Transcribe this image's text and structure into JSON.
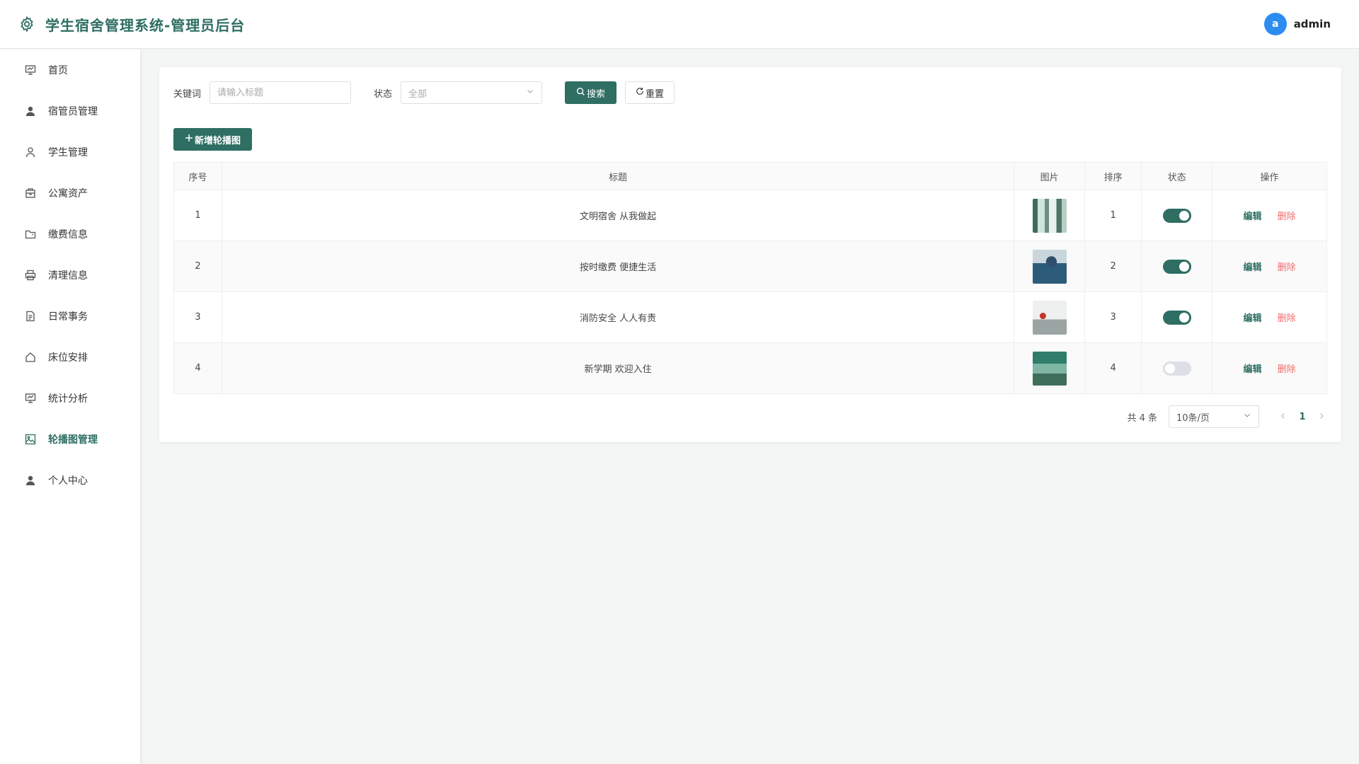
{
  "header": {
    "title": "学生宿舍管理系统-管理员后台",
    "avatar_letter": "a",
    "username": "admin"
  },
  "sidebar": {
    "items": [
      {
        "label": "首页",
        "icon": "dashboard-icon"
      },
      {
        "label": "宿管员管理",
        "icon": "user-filled-icon"
      },
      {
        "label": "学生管理",
        "icon": "user-icon"
      },
      {
        "label": "公寓资产",
        "icon": "package-icon"
      },
      {
        "label": "缴费信息",
        "icon": "folder-icon"
      },
      {
        "label": "清理信息",
        "icon": "printer-icon"
      },
      {
        "label": "日常事务",
        "icon": "document-icon"
      },
      {
        "label": "床位安排",
        "icon": "home-icon"
      },
      {
        "label": "统计分析",
        "icon": "chart-icon"
      },
      {
        "label": "轮播图管理",
        "icon": "picture-icon",
        "active": true
      },
      {
        "label": "个人中心",
        "icon": "user-filled-icon"
      }
    ]
  },
  "filters": {
    "keyword_label": "关键词",
    "keyword_placeholder": "请输入标题",
    "status_label": "状态",
    "status_value": "全部",
    "search_label": "搜索",
    "reset_label": "重置"
  },
  "add_button": "新增轮播图",
  "table": {
    "headers": [
      "序号",
      "标题",
      "图片",
      "排序",
      "状态",
      "操作"
    ],
    "rows": [
      {
        "index": "1",
        "title": "文明宿舍 从我做起",
        "sort": "1",
        "enabled": true
      },
      {
        "index": "2",
        "title": "按时缴费 便捷生活",
        "sort": "2",
        "enabled": true
      },
      {
        "index": "3",
        "title": "消防安全 人人有责",
        "sort": "3",
        "enabled": true
      },
      {
        "index": "4",
        "title": "新学期 欢迎入住",
        "sort": "4",
        "enabled": false
      }
    ],
    "edit_label": "编辑",
    "delete_label": "删除"
  },
  "pagination": {
    "total": "共 4 条",
    "page_size": "10条/页",
    "current_page": "1"
  },
  "colors": {
    "accent": "#2e6e63",
    "danger": "#f56c6c",
    "avatar": "#2d8cf0"
  }
}
